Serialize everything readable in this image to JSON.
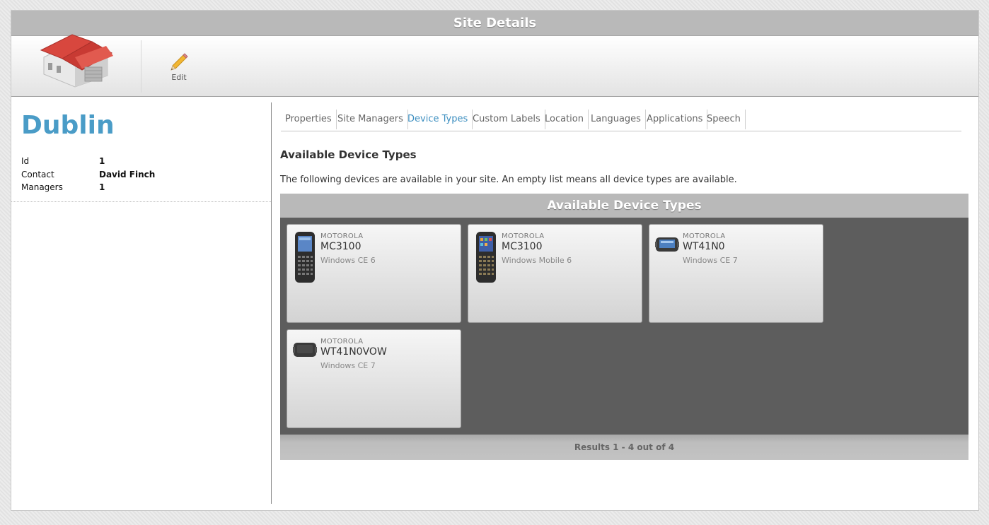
{
  "window": {
    "title": "Site Details"
  },
  "toolbar": {
    "edit_label": "Edit"
  },
  "site": {
    "name": "Dublin",
    "properties": [
      {
        "key": "Id",
        "value": "1"
      },
      {
        "key": "Contact",
        "value": "David Finch"
      },
      {
        "key": "Managers",
        "value": "1"
      }
    ]
  },
  "tabs": [
    {
      "label": "Properties",
      "active": false
    },
    {
      "label": "Site Managers",
      "active": false
    },
    {
      "label": "Device Types",
      "active": true
    },
    {
      "label": "Custom Labels",
      "active": false
    },
    {
      "label": "Location",
      "active": false
    },
    {
      "label": "Languages",
      "active": false
    },
    {
      "label": "Applications",
      "active": false
    },
    {
      "label": "Speech",
      "active": false
    }
  ],
  "section": {
    "title": "Available Device Types",
    "description": "The following devices are available in your site. An empty list means all device types are available."
  },
  "grid": {
    "header": "Available Device Types",
    "devices": [
      {
        "vendor": "MOTOROLA",
        "model": "MC3100",
        "os": "Windows CE 6",
        "icon": "handheld-scanner-icon"
      },
      {
        "vendor": "MOTOROLA",
        "model": "MC3100",
        "os": "Windows Mobile 6",
        "icon": "handheld-scanner-color-icon"
      },
      {
        "vendor": "MOTOROLA",
        "model": "WT41N0",
        "os": "Windows CE 7",
        "icon": "wearable-terminal-icon"
      },
      {
        "vendor": "MOTOROLA",
        "model": "WT41N0VOW",
        "os": "Windows CE 7",
        "icon": "wearable-terminal-voice-icon"
      }
    ],
    "footer": "Results 1 - 4 out of 4"
  },
  "colors": {
    "accent": "#4a9cc7",
    "header_bg": "#b9b9b9",
    "grid_bg": "#5d5d5d"
  }
}
